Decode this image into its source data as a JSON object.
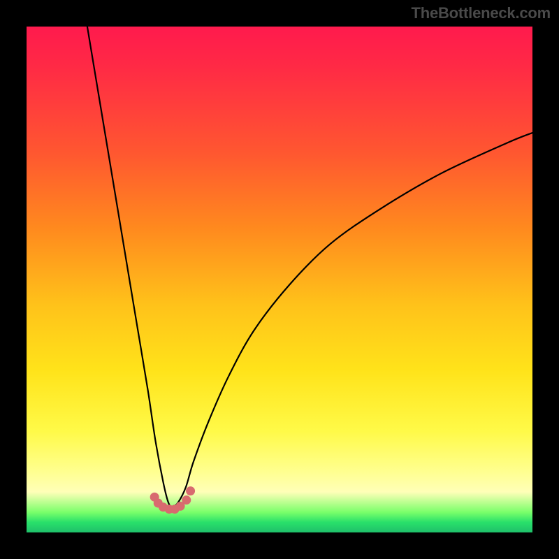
{
  "watermark": "TheBottleneck.com",
  "chart_data": {
    "type": "line",
    "title": "",
    "xlabel": "",
    "ylabel": "",
    "xlim": [
      0,
      100
    ],
    "ylim": [
      0,
      100
    ],
    "grid": false,
    "legend": false,
    "series": [
      {
        "name": "bottleneck-curve",
        "x": [
          12,
          14,
          16,
          18,
          20,
          22,
          24,
          25.5,
          27,
          28,
          28.8,
          30,
          31.5,
          33,
          36,
          40,
          45,
          52,
          60,
          70,
          82,
          95,
          100
        ],
        "y": [
          100,
          88,
          76,
          64,
          52,
          40,
          28,
          18,
          10,
          6,
          5,
          6,
          9,
          14,
          22,
          31,
          40,
          49,
          57,
          64,
          71,
          77,
          79
        ]
      }
    ],
    "markers": {
      "name": "bottom-dots",
      "color": "#d86a6f",
      "x": [
        25.3,
        26.0,
        27.0,
        28.2,
        29.3,
        30.4,
        31.6,
        32.4
      ],
      "y": [
        7.0,
        5.8,
        5.0,
        4.6,
        4.6,
        5.2,
        6.4,
        8.2
      ]
    },
    "background_gradient": {
      "top": "#ff1a4d",
      "mid": "#ffe31a",
      "bottom": "#1fc06a"
    }
  }
}
